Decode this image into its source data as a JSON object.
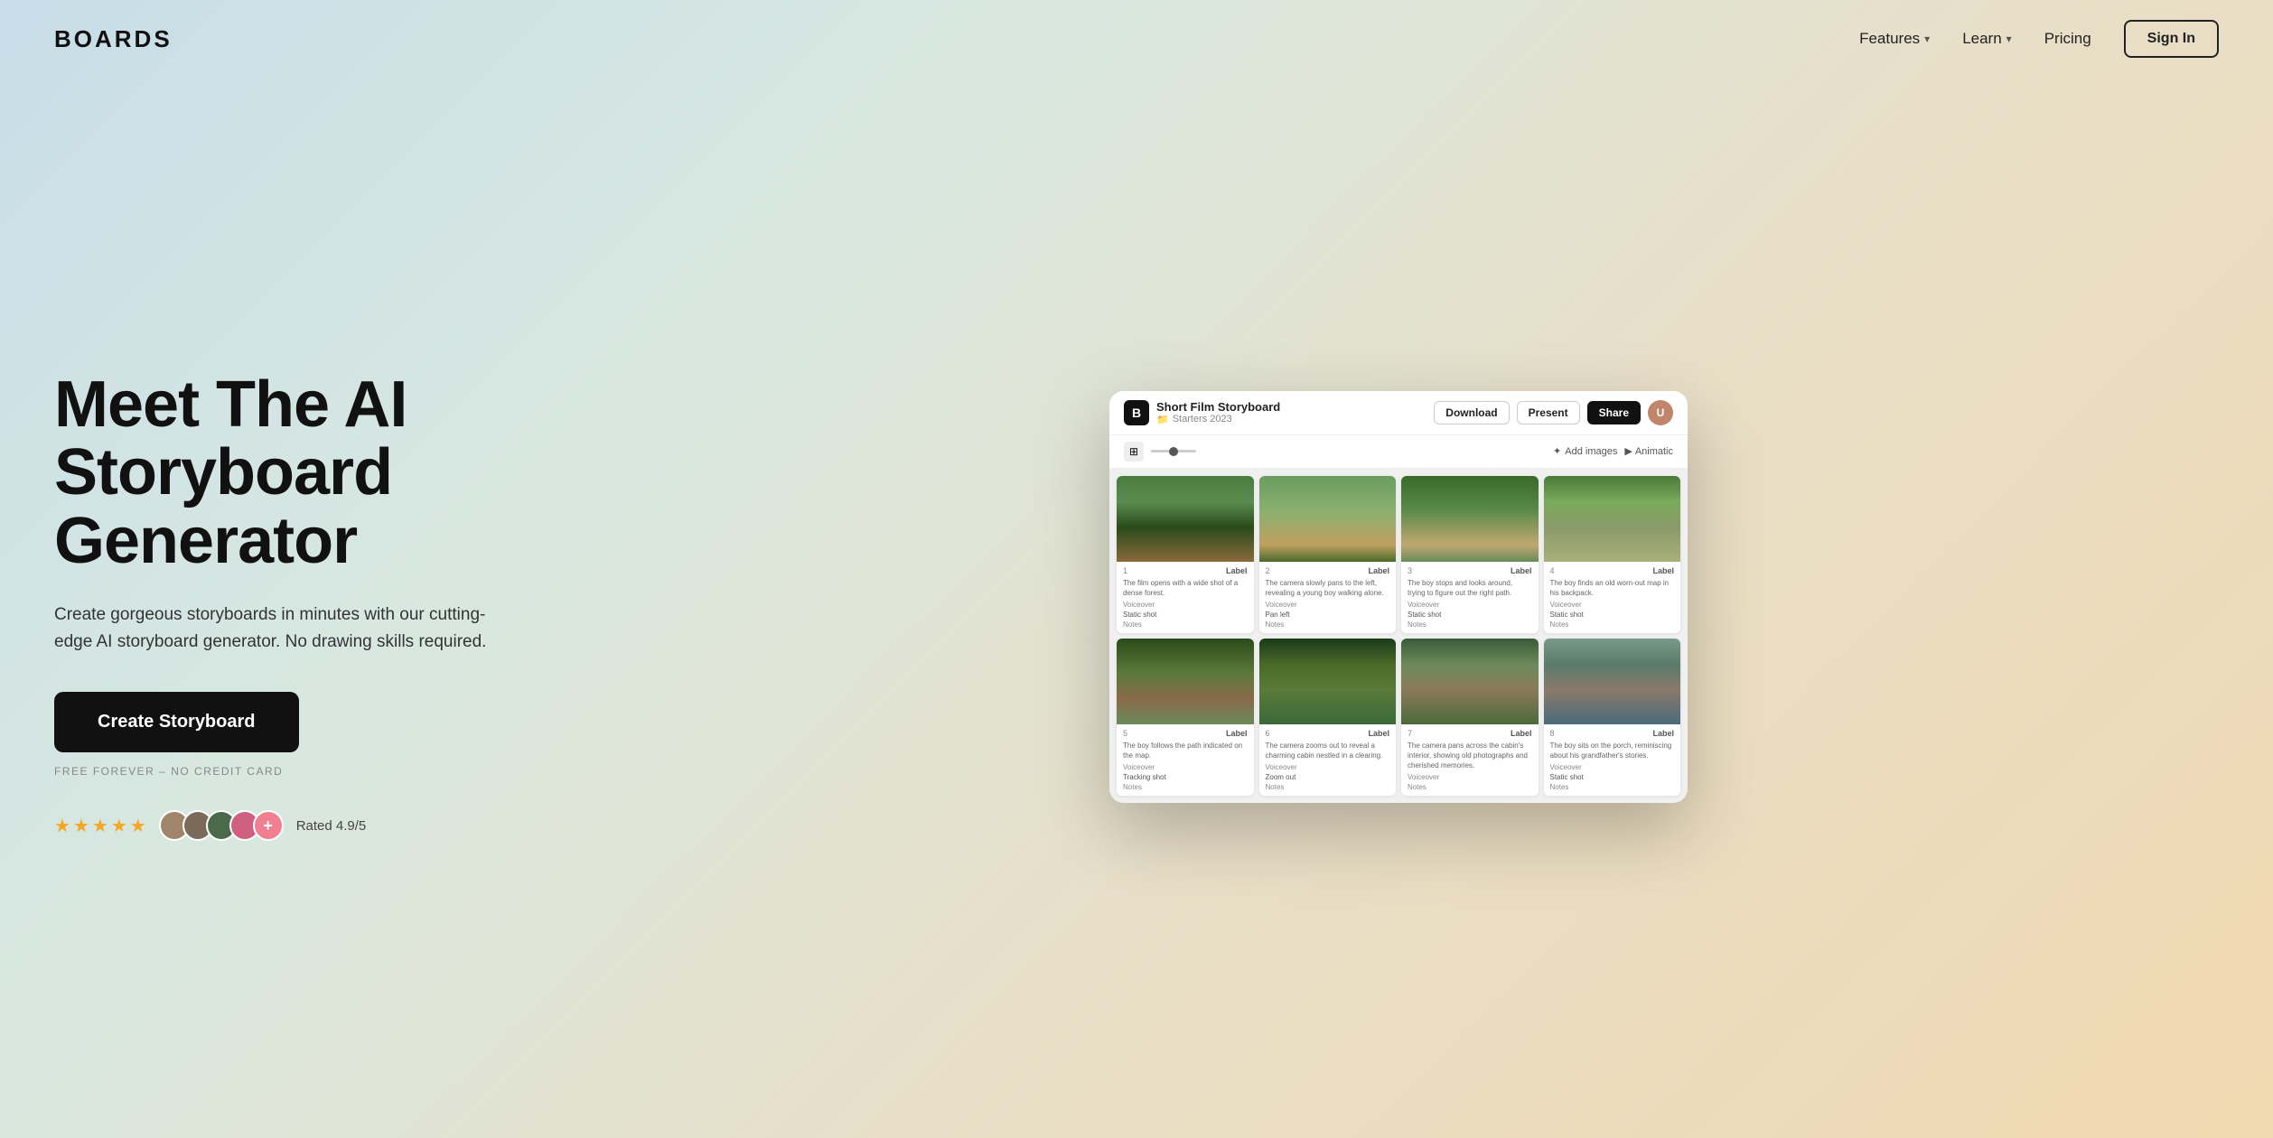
{
  "nav": {
    "logo": "BOARDS",
    "links": [
      {
        "label": "Features",
        "hasChevron": true
      },
      {
        "label": "Learn",
        "hasChevron": true
      },
      {
        "label": "Pricing",
        "hasChevron": false
      }
    ],
    "signIn": "Sign In"
  },
  "hero": {
    "title": "Meet The AI Storyboard Generator",
    "subtitle": "Create gorgeous storyboards in minutes with our cutting-edge AI storyboard generator. No drawing skills required.",
    "cta": "Create Storyboard",
    "freeLabel": "FREE FOREVER – NO CREDIT CARD",
    "rating": {
      "stars": 5,
      "text": "Rated 4.9/5"
    }
  },
  "app": {
    "projectName": "Short Film Storyboard",
    "projectSub": "Starters 2023",
    "toolbar": {
      "download": "Download",
      "present": "Present",
      "share": "Share"
    },
    "subtoolbar": {
      "addImages": "Add images",
      "animatic": "Animatic"
    },
    "cards": [
      {
        "num": "1",
        "label": "Label",
        "desc": "The film opens with a wide shot of a dense forest.",
        "field1": "Voiceover",
        "field2": "Static shot",
        "notes": "Notes"
      },
      {
        "num": "2",
        "label": "Label",
        "desc": "The camera slowly pans to the left, revealing a young boy walking alone.",
        "field1": "Voiceover",
        "field2": "Pan left",
        "notes": "Notes"
      },
      {
        "num": "3",
        "label": "Label",
        "desc": "The boy stops and looks around, trying to figure out the right path.",
        "field1": "Voiceover",
        "field2": "Static shot",
        "notes": "Notes"
      },
      {
        "num": "4",
        "label": "Label",
        "desc": "The boy finds an old worn-out map in his backpack.",
        "field1": "Voiceover",
        "field2": "Static shot",
        "notes": "Notes"
      },
      {
        "num": "5",
        "label": "Label",
        "desc": "The boy follows the path indicated on the map.",
        "field1": "Voiceover",
        "field2": "Tracking shot",
        "notes": ""
      },
      {
        "num": "6",
        "label": "Label",
        "desc": "The camera zooms out to reveal a charming cabin nestled in a clearing.",
        "field1": "Voiceover",
        "field2": "Zoom out",
        "notes": ""
      },
      {
        "num": "7",
        "label": "Label",
        "desc": "The camera pans across the cabin's interior, showing old photographs and cherished memories.",
        "field1": "Voiceover",
        "field2": "",
        "notes": ""
      },
      {
        "num": "8",
        "label": "Label",
        "desc": "The boy sits on the porch, reminiscing about his grandfather's stories.",
        "field1": "Voiceover",
        "field2": "Static shot",
        "notes": ""
      }
    ]
  }
}
